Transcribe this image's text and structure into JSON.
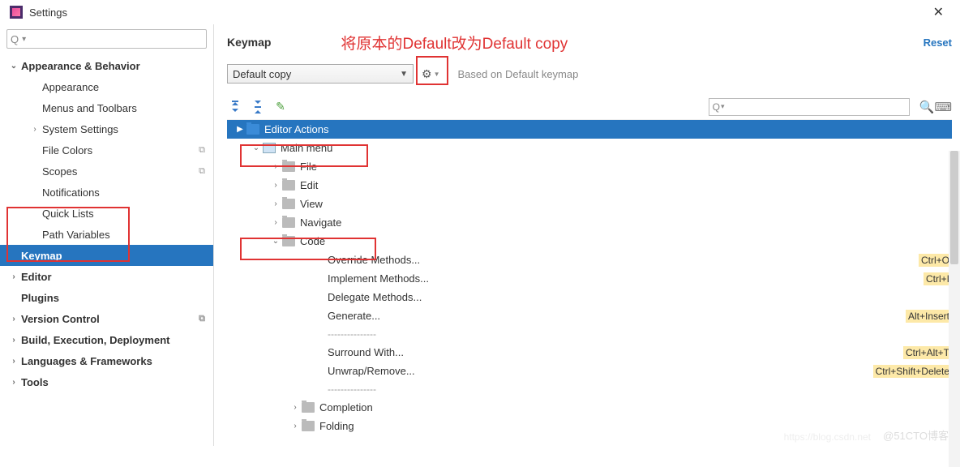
{
  "titlebar": {
    "title": "Settings"
  },
  "annotation": "将原本的Default改为Default copy",
  "sidebar": {
    "search_placeholder": "",
    "items": [
      {
        "label": "Appearance & Behavior",
        "bold": true,
        "arrow": "down",
        "indent": 0
      },
      {
        "label": "Appearance",
        "indent": 1
      },
      {
        "label": "Menus and Toolbars",
        "indent": 1
      },
      {
        "label": "System Settings",
        "arrow": "right",
        "indent": 1
      },
      {
        "label": "File Colors",
        "indent": 1,
        "badge": "⧉"
      },
      {
        "label": "Scopes",
        "indent": 1,
        "badge": "⧉"
      },
      {
        "label": "Notifications",
        "indent": 1
      },
      {
        "label": "Quick Lists",
        "indent": 1
      },
      {
        "label": "Path Variables",
        "indent": 1
      },
      {
        "label": "Keymap",
        "bold": true,
        "indent": 0,
        "selected": true
      },
      {
        "label": "Editor",
        "bold": true,
        "arrow": "right",
        "indent": 0
      },
      {
        "label": "Plugins",
        "bold": true,
        "indent": 0
      },
      {
        "label": "Version Control",
        "bold": true,
        "arrow": "right",
        "indent": 0,
        "badge": "⧉"
      },
      {
        "label": "Build, Execution, Deployment",
        "bold": true,
        "arrow": "right",
        "indent": 0
      },
      {
        "label": "Languages & Frameworks",
        "bold": true,
        "arrow": "right",
        "indent": 0
      },
      {
        "label": "Tools",
        "bold": true,
        "arrow": "right",
        "indent": 0
      }
    ]
  },
  "main": {
    "title": "Keymap",
    "reset": "Reset",
    "dropdown_value": "Default copy",
    "based_on": "Based on Default keymap",
    "tree": {
      "editor_actions": "Editor Actions",
      "main_menu": "Main menu",
      "file": "File",
      "edit": "Edit",
      "view": "View",
      "navigate": "Navigate",
      "code": "Code",
      "override": "Override Methods...",
      "implement": "Implement Methods...",
      "delegate": "Delegate Methods...",
      "generate": "Generate...",
      "sep": "---------------",
      "surround": "Surround With...",
      "unwrap": "Unwrap/Remove...",
      "completion": "Completion",
      "folding": "Folding"
    },
    "shortcuts": {
      "override": "Ctrl+O",
      "implement": "Ctrl+I",
      "generate": "Alt+Insert",
      "surround": "Ctrl+Alt+T",
      "unwrap": "Ctrl+Shift+Delete"
    }
  },
  "watermark": "@51CTO博客",
  "watermark2": "https://blog.csdn.net"
}
